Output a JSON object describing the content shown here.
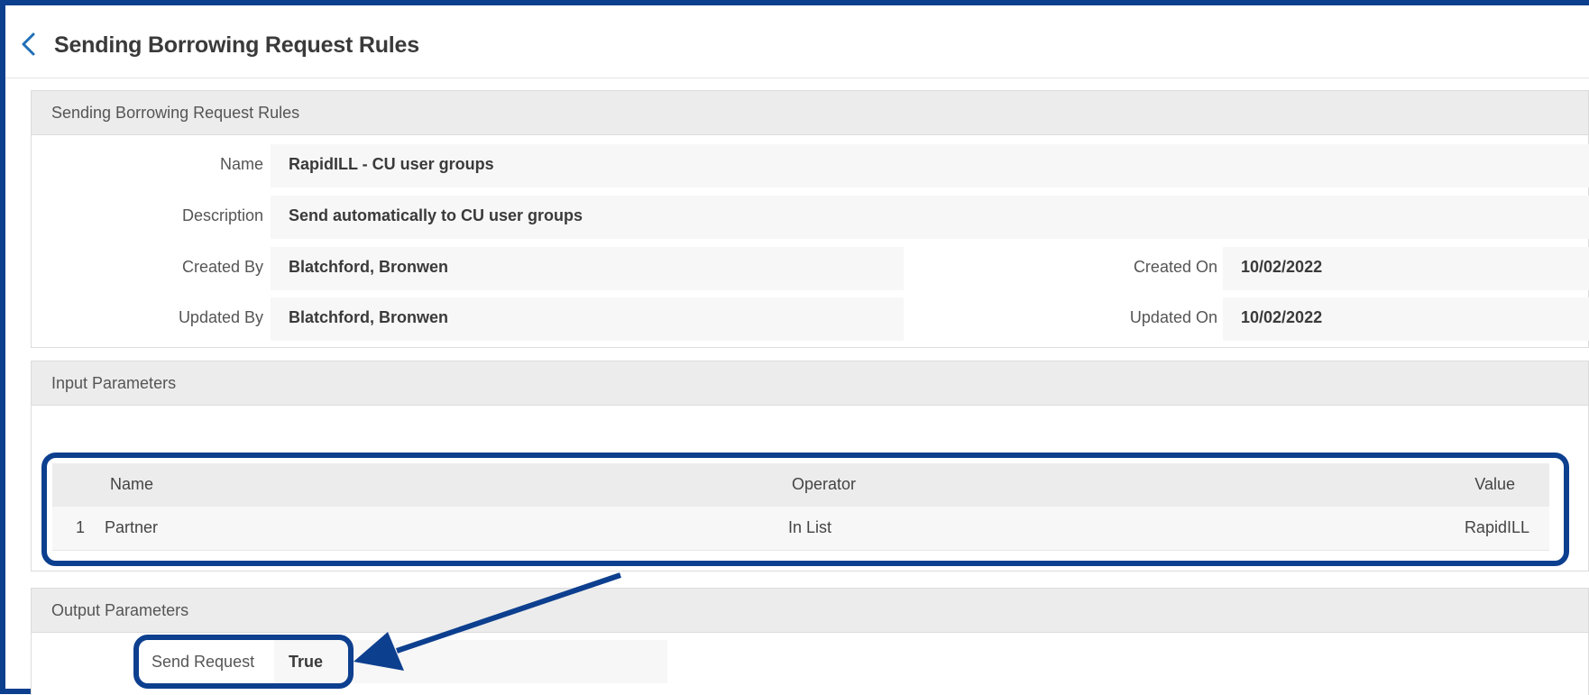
{
  "page": {
    "title": "Sending Borrowing Request Rules"
  },
  "general": {
    "header": "Sending Borrowing Request Rules",
    "name_label": "Name",
    "name_value": "RapidILL - CU user groups",
    "description_label": "Description",
    "description_value": "Send automatically to CU user groups",
    "created_by_label": "Created By",
    "created_by_value": "Blatchford, Bronwen",
    "created_on_label": "Created On",
    "created_on_value": "10/02/2022",
    "updated_by_label": "Updated By",
    "updated_by_value": "Blatchford, Bronwen",
    "updated_on_label": "Updated On",
    "updated_on_value": "10/02/2022"
  },
  "input_parameters": {
    "header": "Input Parameters",
    "columns": {
      "name": "Name",
      "operator": "Operator",
      "value": "Value"
    },
    "rows": [
      {
        "index": "1",
        "name": "Partner",
        "operator": "In List",
        "value": "RapidILL"
      }
    ]
  },
  "output_parameters": {
    "header": "Output Parameters",
    "send_request_label": "Send Request",
    "send_request_value": "True"
  },
  "colors": {
    "annotation_blue": "#0d3f8f",
    "section_header_bg": "#ececec",
    "field_bg": "#f7f7f7"
  },
  "icons": {
    "back": "chevron-left-icon",
    "annotation_arrow": "arrow-icon"
  }
}
